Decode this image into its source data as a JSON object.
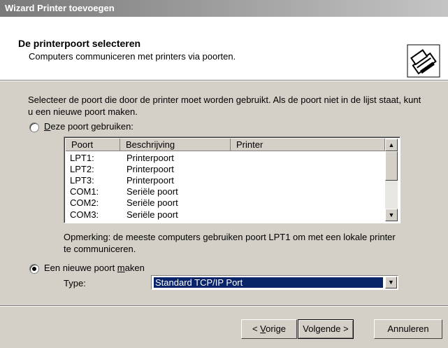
{
  "window": {
    "title": "Wizard Printer toevoegen"
  },
  "header": {
    "title": "De printerpoort selecteren",
    "subtitle": "Computers communiceren met printers via poorten.",
    "icon": "printer-icon"
  },
  "intro": "Selecteer de poort die door de printer moet worden gebruikt. Als de poort niet in de lijst staat, kunt u een nieuwe poort maken.",
  "option_existing": {
    "label": "Deze poort gebruiken:",
    "accel": "D",
    "rest": "eze poort gebruiken:",
    "selected": false
  },
  "ports": {
    "columns": [
      "Poort",
      "Beschrijving",
      "Printer"
    ],
    "rows": [
      [
        "LPT1:",
        "Printerpoort",
        ""
      ],
      [
        "LPT2:",
        "Printerpoort",
        ""
      ],
      [
        "LPT3:",
        "Printerpoort",
        ""
      ],
      [
        "COM1:",
        "Seriële poort",
        ""
      ],
      [
        "COM2:",
        "Seriële poort",
        ""
      ],
      [
        "COM3:",
        "Seriële poort",
        ""
      ]
    ]
  },
  "note": "Opmerking: de meeste computers gebruiken poort LPT1 om met een lokale printer te communiceren.",
  "option_new": {
    "label": "Een nieuwe poort maken",
    "before": "Een nieuwe poort ",
    "accel": "m",
    "after": "aken",
    "selected": true
  },
  "type": {
    "label": "Type:",
    "value": "Standard TCP/IP Port"
  },
  "buttons": {
    "back": {
      "label": "< Vorige",
      "before": "< ",
      "accel": "V",
      "after": "orige"
    },
    "next": "Volgende >",
    "cancel": "Annuleren"
  }
}
